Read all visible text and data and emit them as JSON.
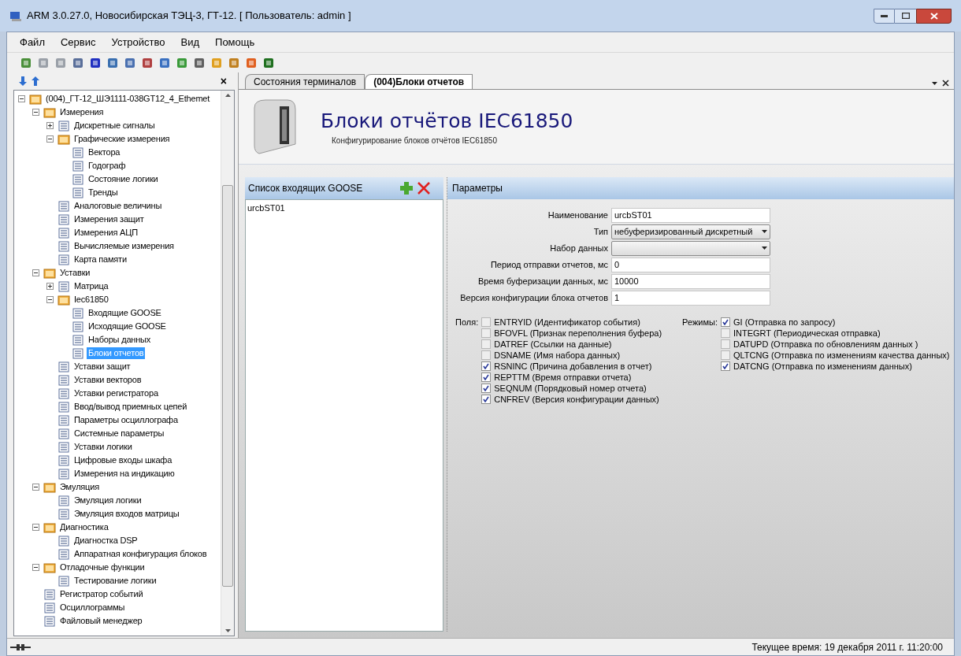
{
  "window": {
    "title": "ARM 3.0.27.0, Новосибирская ТЭЦ-3, ГТ-12. [ Пользователь: admin ]"
  },
  "menu": [
    "Файл",
    "Сервис",
    "Устройство",
    "Вид",
    "Помощь"
  ],
  "tree_panel": {
    "close": "×"
  },
  "tree": [
    {
      "label": "(004)_ГТ-12_ШЭ1111-038GT12_4_Ethemet",
      "expanded": true,
      "selected": false,
      "children": [
        {
          "label": "Измерения",
          "expanded": true,
          "selected": false,
          "children": [
            {
              "label": "Дискретные сигналы",
              "expanded": false,
              "selected": false
            },
            {
              "label": "Графические измерения",
              "expanded": true,
              "selected": false,
              "children": [
                {
                  "label": "Вектора",
                  "selected": false
                },
                {
                  "label": "Годограф",
                  "selected": false
                },
                {
                  "label": "Состояние логики",
                  "selected": false
                },
                {
                  "label": "Тренды",
                  "selected": false
                }
              ]
            },
            {
              "label": "Аналоговые величины",
              "selected": false
            },
            {
              "label": "Измерения защит",
              "selected": false
            },
            {
              "label": "Измерения АЦП",
              "selected": false
            },
            {
              "label": "Вычисляемые измерения",
              "selected": false
            },
            {
              "label": "Карта памяти",
              "selected": false
            }
          ]
        },
        {
          "label": "Уставки",
          "expanded": true,
          "selected": false,
          "children": [
            {
              "label": "Матрица",
              "expanded": false,
              "selected": false
            },
            {
              "label": "Iec61850",
              "expanded": true,
              "selected": false,
              "children": [
                {
                  "label": "Входящие GOOSE",
                  "selected": false
                },
                {
                  "label": "Исходящие GOOSE",
                  "selected": false
                },
                {
                  "label": "Наборы данных",
                  "selected": false
                },
                {
                  "label": "Блоки отчетов",
                  "selected": true
                }
              ]
            },
            {
              "label": "Уставки защит",
              "selected": false
            },
            {
              "label": "Уставки векторов",
              "selected": false
            },
            {
              "label": "Уставки регистратора",
              "selected": false
            },
            {
              "label": "Ввод/вывод приемных цепей",
              "selected": false
            },
            {
              "label": "Параметры осциллографа",
              "selected": false
            },
            {
              "label": "Системные параметры",
              "selected": false
            },
            {
              "label": "Уставки логики",
              "selected": false
            },
            {
              "label": "Цифровые входы шкафа",
              "selected": false
            },
            {
              "label": "Измерения на индикацию",
              "selected": false
            }
          ]
        },
        {
          "label": "Эмуляция",
          "expanded": true,
          "selected": false,
          "children": [
            {
              "label": "Эмуляция логики",
              "selected": false
            },
            {
              "label": "Эмуляция входов матрицы",
              "selected": false
            }
          ]
        },
        {
          "label": "Диагностика",
          "expanded": true,
          "selected": false,
          "children": [
            {
              "label": "Диагностка DSP",
              "selected": false
            },
            {
              "label": "Аппаратная конфигурация блоков",
              "selected": false
            }
          ]
        },
        {
          "label": "Отладочные функции",
          "expanded": true,
          "selected": false,
          "children": [
            {
              "label": "Тестирование логики",
              "selected": false
            }
          ]
        },
        {
          "label": "Регистратор событий",
          "selected": false
        },
        {
          "label": "Осциллограммы",
          "selected": false
        },
        {
          "label": "Файловый менеджер",
          "selected": false
        }
      ]
    }
  ],
  "tabs": [
    {
      "label": "Состояния терминалов",
      "selected": false
    },
    {
      "label": "(004)Блоки отчетов",
      "selected": true
    }
  ],
  "header": {
    "title": "Блоки отчётов IEC61850",
    "subtitle": "Конфигурирование блоков отчётов IEC61850"
  },
  "list_panel": {
    "title": "Список входящих GOOSE",
    "items": [
      "urcbST01"
    ]
  },
  "params_panel": {
    "title": "Параметры",
    "fields": [
      {
        "label": "Наименование",
        "kind": "text",
        "value": "urcbST01"
      },
      {
        "label": "Тип",
        "kind": "dropdown",
        "value": "небуферизированный дискретный"
      },
      {
        "label": "Набор данных",
        "kind": "dropdown"
      },
      {
        "label": "Период отправки отчетов, мс",
        "kind": "text",
        "value": "0"
      },
      {
        "label": "Время буферизации данных, мс",
        "kind": "text",
        "value": "10000"
      },
      {
        "label": "Версия конфигурации блока отчетов",
        "kind": "text",
        "value": "1"
      }
    ],
    "groups": [
      {
        "label": "Поля:",
        "options": [
          {
            "label": "ENTRYID (Идентификатор события)",
            "checked": false
          },
          {
            "label": "BFOVFL (Признак переполнения буфера)",
            "checked": false
          },
          {
            "label": "DATREF (Ссылки на данные)",
            "checked": false
          },
          {
            "label": "DSNAME (Имя набора данных)",
            "checked": false
          },
          {
            "label": "RSNINC (Причина добавления в отчет)",
            "checked": true
          },
          {
            "label": "REPTTM (Время отправки отчета)",
            "checked": true
          },
          {
            "label": "SEQNUM (Порядковый номер отчета)",
            "checked": true
          },
          {
            "label": "CNFREV (Версия конфигурации данных)",
            "checked": true
          }
        ]
      },
      {
        "label": "Режимы:",
        "options": [
          {
            "label": "GI (Отправка по запросу)",
            "checked": true
          },
          {
            "label": "INTEGRT (Периодическая отправка)",
            "checked": false
          },
          {
            "label": "DATUPD (Отправка по обновлениям данных )",
            "checked": false
          },
          {
            "label": "QLTCNG (Отправка по изменениям качества данных)",
            "checked": false
          },
          {
            "label": "DATCNG (Отправка по изменениям данных)",
            "checked": true
          }
        ]
      }
    ]
  },
  "status_bar": {
    "text": "Текущее время: 19 декабря 2011 г. 11:20:00"
  }
}
